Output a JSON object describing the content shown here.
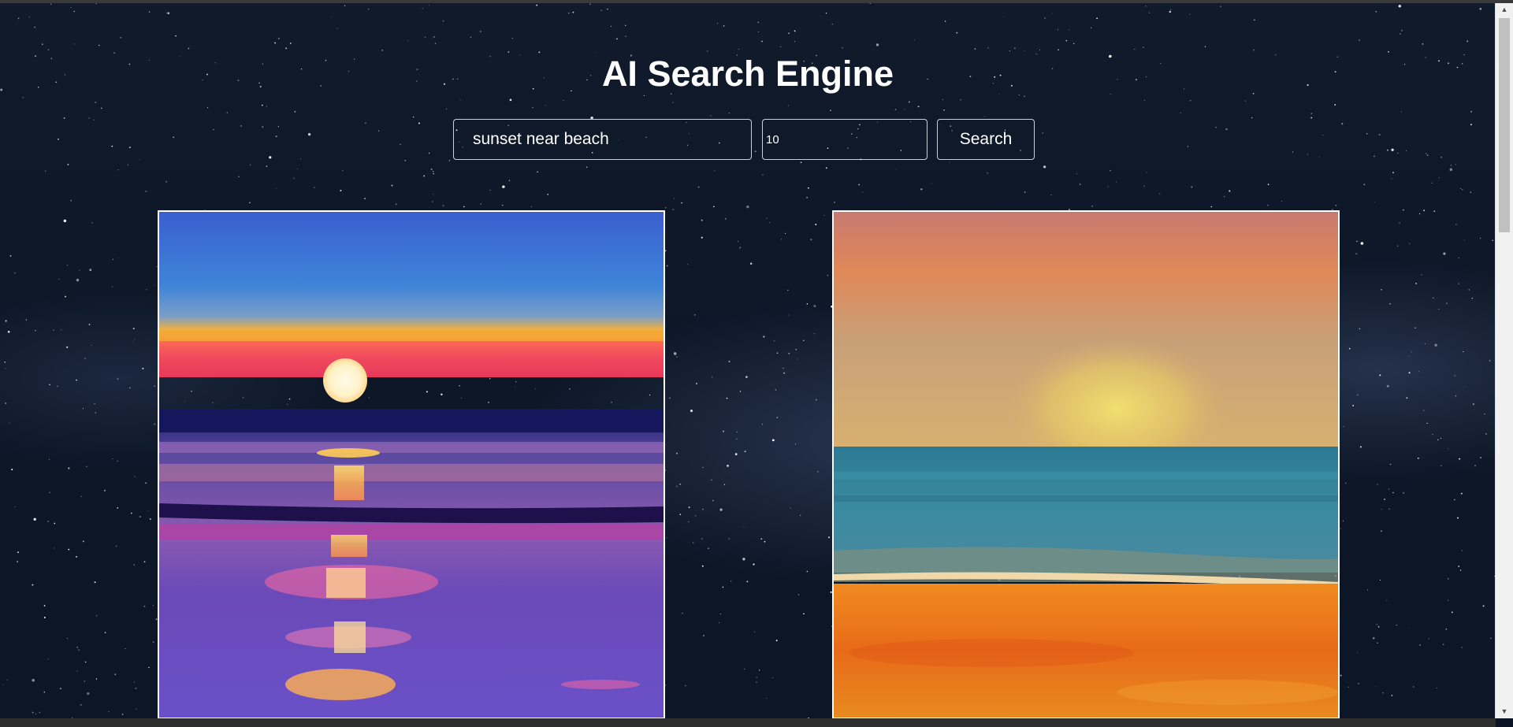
{
  "page": {
    "title": "AI Search Engine"
  },
  "search": {
    "query_value": "sunset near beach",
    "count_value": "10",
    "button_label": "Search"
  },
  "results": [
    {
      "name": "result-image-1",
      "theme": "painted sunset over ocean with pink sky and purple water"
    },
    {
      "name": "result-image-2",
      "theme": "painted sunset over teal sea with orange sand"
    }
  ]
}
